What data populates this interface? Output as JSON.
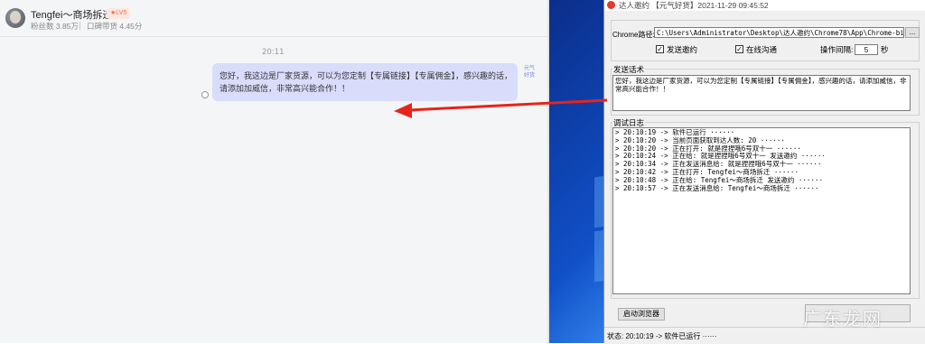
{
  "chat": {
    "name": "Tengfei～商场拆迁",
    "level_badge": "★LV5",
    "fans": "粉丝数 3.85万",
    "sales": "口碑带货 4.45分",
    "time": "20:11",
    "message": "您好，我这边是厂家货源，可以为您定制【专属链接】【专属佣金】，感兴趣的话，请添加加威信，非常高兴能合作！！",
    "sender_tag": "元气好货"
  },
  "app": {
    "title": "达人邀约 【元气好货】2021-11-29 09:45:52",
    "chrome_label": "Chrome路径:",
    "chrome_path": "C:\\Users\\Administrator\\Desktop\\达人邀约\\Chrome78\\App\\Chrome-bin\\chrome.exe",
    "browse_label": "...",
    "checkbox_send": {
      "label": "发送邀约",
      "checked": true
    },
    "checkbox_online": {
      "label": "在线沟通",
      "checked": true
    },
    "interval_label": "操作间隔:",
    "interval_value": "5",
    "interval_unit": "秒",
    "message_group_title": "发送话术",
    "message_text": "您好，我这边是厂家货源，可以为您定制【专属链接】【专属佣金】，感兴趣的话，请添加威信，非常高兴能合作！！",
    "log_group_title": "调试日志",
    "log_lines": [
      "> 20:10:19 -> 软件已运行 ······",
      "> 20:10:20 -> 当前页面获取到达人数: 20 ······",
      "> 20:10:20 -> 正在打开: 就是捏捏哦6号双十一 ······",
      "> 20:10:24 -> 正在给: 就是捏捏哦6号双十一 发送邀约 ······",
      "> 20:10:34 -> 正在发送消息给: 就是捏捏哦6号双十一 ······",
      "> 20:10:42 -> 正在打开: Tengfei～商场拆迁 ······",
      "> 20:10:48 -> 正在给: Tengfei～商场拆迁 发送邀约 ······",
      "> 20:10:57 -> 正在发送消息给: Tengfei～商场拆迁 ······"
    ],
    "start_button": "启动浏览器",
    "status_label": "状态:",
    "status_text": "20:10:19 -> 软件已运行 ······"
  },
  "watermark": "广东龙网",
  "colors": {
    "arrow": "#e8231b",
    "bubble": "#d9ddfb",
    "desktop": "#1050c8"
  }
}
